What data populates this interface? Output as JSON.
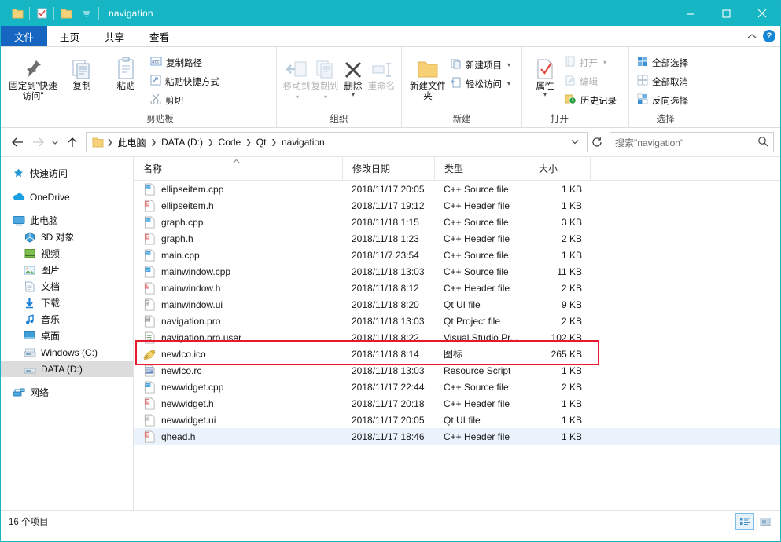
{
  "window": {
    "title": "navigation",
    "quick_access": [
      "folder-icon",
      "properties-icon",
      "new-folder-icon",
      "customize-dropdown-icon"
    ],
    "buttons": {
      "minimize": "minimize-icon",
      "maximize": "maximize-icon",
      "close": "close-icon"
    },
    "accent_color": "#16b6c4"
  },
  "tabs": [
    {
      "label": "文件",
      "name": "tab-file"
    },
    {
      "label": "主页",
      "name": "tab-home"
    },
    {
      "label": "共享",
      "name": "tab-share"
    },
    {
      "label": "查看",
      "name": "tab-view"
    }
  ],
  "ribbon": {
    "collapse_icon": "chevron-up-icon",
    "help_icon": "help-icon",
    "groups": [
      {
        "label": "剪贴板",
        "name": "ribbon-group-clipboard",
        "big": [
          {
            "label": "固定到\"快速访问\"",
            "icon": "pin-icon",
            "disabled": false
          },
          {
            "label": "复制",
            "icon": "copy-icon",
            "disabled": false
          },
          {
            "label": "粘贴",
            "icon": "paste-icon",
            "disabled": false
          }
        ],
        "small": [
          {
            "label": "复制路径",
            "icon": "copy-path-icon",
            "disabled": false
          },
          {
            "label": "粘贴快捷方式",
            "icon": "paste-shortcut-icon",
            "disabled": false
          },
          {
            "label": "剪切",
            "icon": "cut-icon",
            "disabled": false
          }
        ]
      },
      {
        "label": "组织",
        "name": "ribbon-group-organize",
        "big": [
          {
            "label": "移动到",
            "icon": "move-to-icon",
            "disabled": true,
            "dropdown": true
          },
          {
            "label": "复制到",
            "icon": "copy-to-icon",
            "disabled": true,
            "dropdown": true
          },
          {
            "label": "删除",
            "icon": "delete-icon",
            "disabled": false,
            "dropdown": true
          },
          {
            "label": "重命名",
            "icon": "rename-icon",
            "disabled": true
          }
        ],
        "small": []
      },
      {
        "label": "新建",
        "name": "ribbon-group-new",
        "big": [
          {
            "label": "新建文件夹",
            "icon": "new-folder-icon",
            "disabled": false
          }
        ],
        "small": [
          {
            "label": "新建项目",
            "icon": "new-item-icon",
            "dropdown": true
          },
          {
            "label": "轻松访问",
            "icon": "easy-access-icon",
            "dropdown": true
          }
        ]
      },
      {
        "label": "打开",
        "name": "ribbon-group-open",
        "big": [
          {
            "label": "属性",
            "icon": "properties-icon",
            "disabled": false,
            "dropdown": true
          }
        ],
        "small": [
          {
            "label": "打开",
            "icon": "open-icon",
            "disabled": true,
            "dropdown": true
          },
          {
            "label": "编辑",
            "icon": "edit-icon",
            "disabled": true
          },
          {
            "label": "历史记录",
            "icon": "history-icon",
            "disabled": false
          }
        ]
      },
      {
        "label": "选择",
        "name": "ribbon-group-select",
        "big": [],
        "small": [
          {
            "label": "全部选择",
            "icon": "select-all-icon"
          },
          {
            "label": "全部取消",
            "icon": "select-none-icon"
          },
          {
            "label": "反向选择",
            "icon": "invert-selection-icon"
          }
        ]
      }
    ]
  },
  "address": {
    "back_icon": "back-arrow-icon",
    "forward_icon": "forward-arrow-icon",
    "recent_icon": "chevron-down-icon",
    "up_icon": "up-arrow-icon",
    "folder_icon": "folder-icon",
    "breadcrumbs": [
      "此电脑",
      "DATA (D:)",
      "Code",
      "Qt",
      "navigation"
    ],
    "dropdown_icon": "chevron-down-icon",
    "refresh_icon": "refresh-icon",
    "search_placeholder": "搜索\"navigation\"",
    "search_value": "",
    "search_icon": "search-icon"
  },
  "sidebar": {
    "groups": [
      {
        "items": [
          {
            "label": "快速访问",
            "icon": "star-pin-icon",
            "level": 0,
            "selected": false
          }
        ]
      },
      {
        "items": [
          {
            "label": "OneDrive",
            "icon": "onedrive-cloud-icon",
            "level": 0,
            "selected": false
          }
        ]
      },
      {
        "items": [
          {
            "label": "此电脑",
            "icon": "this-pc-icon",
            "level": 0,
            "selected": false
          },
          {
            "label": "3D 对象",
            "icon": "3d-objects-icon",
            "level": 1,
            "selected": false
          },
          {
            "label": "视频",
            "icon": "videos-icon",
            "level": 1,
            "selected": false
          },
          {
            "label": "图片",
            "icon": "pictures-icon",
            "level": 1,
            "selected": false
          },
          {
            "label": "文档",
            "icon": "documents-icon",
            "level": 1,
            "selected": false
          },
          {
            "label": "下载",
            "icon": "downloads-icon",
            "level": 1,
            "selected": false
          },
          {
            "label": "音乐",
            "icon": "music-icon",
            "level": 1,
            "selected": false
          },
          {
            "label": "桌面",
            "icon": "desktop-icon",
            "level": 1,
            "selected": false
          },
          {
            "label": "Windows (C:)",
            "icon": "drive-icon",
            "level": 1,
            "selected": false
          },
          {
            "label": "DATA (D:)",
            "icon": "drive-icon",
            "level": 1,
            "selected": true
          }
        ]
      },
      {
        "items": [
          {
            "label": "网络",
            "icon": "network-icon",
            "level": 0,
            "selected": false
          }
        ]
      }
    ]
  },
  "filelist": {
    "columns": [
      {
        "label": "名称",
        "name": "column-name",
        "sorted": true,
        "sort_icon": "sort-asc-icon"
      },
      {
        "label": "修改日期",
        "name": "column-date"
      },
      {
        "label": "类型",
        "name": "column-type"
      },
      {
        "label": "大小",
        "name": "column-size"
      }
    ],
    "rows": [
      {
        "name": "ellipseitem.cpp",
        "date": "2018/11/17 20:05",
        "type": "C++ Source file",
        "size": "1 KB",
        "icon": "cpp-file-icon",
        "hover": false,
        "highlight": false
      },
      {
        "name": "ellipseitem.h",
        "date": "2018/11/17 19:12",
        "type": "C++ Header file",
        "size": "1 KB",
        "icon": "h-file-icon",
        "hover": false,
        "highlight": false
      },
      {
        "name": "graph.cpp",
        "date": "2018/11/18 1:15",
        "type": "C++ Source file",
        "size": "3 KB",
        "icon": "cpp-file-icon",
        "hover": false,
        "highlight": false
      },
      {
        "name": "graph.h",
        "date": "2018/11/18 1:23",
        "type": "C++ Header file",
        "size": "2 KB",
        "icon": "h-file-icon",
        "hover": false,
        "highlight": false
      },
      {
        "name": "main.cpp",
        "date": "2018/11/7 23:54",
        "type": "C++ Source file",
        "size": "1 KB",
        "icon": "cpp-file-icon",
        "hover": false,
        "highlight": false
      },
      {
        "name": "mainwindow.cpp",
        "date": "2018/11/18 13:03",
        "type": "C++ Source file",
        "size": "11 KB",
        "icon": "cpp-file-icon",
        "hover": false,
        "highlight": false
      },
      {
        "name": "mainwindow.h",
        "date": "2018/11/18 8:12",
        "type": "C++ Header file",
        "size": "2 KB",
        "icon": "h-file-icon",
        "hover": false,
        "highlight": false
      },
      {
        "name": "mainwindow.ui",
        "date": "2018/11/18 8:20",
        "type": "Qt UI file",
        "size": "9 KB",
        "icon": "ui-file-icon",
        "hover": false,
        "highlight": false
      },
      {
        "name": "navigation.pro",
        "date": "2018/11/18 13:03",
        "type": "Qt Project file",
        "size": "2 KB",
        "icon": "pro-file-icon",
        "hover": false,
        "highlight": false
      },
      {
        "name": "navigation.pro.user",
        "date": "2018/11/18 8:22",
        "type": "Visual Studio Pr...",
        "size": "102 KB",
        "icon": "user-file-icon",
        "hover": false,
        "highlight": false
      },
      {
        "name": "newIco.ico",
        "date": "2018/11/18 8:14",
        "type": "图标",
        "size": "265 KB",
        "icon": "ico-file-icon",
        "hover": false,
        "highlight": true
      },
      {
        "name": "newIco.rc",
        "date": "2018/11/18 13:03",
        "type": "Resource Script",
        "size": "1 KB",
        "icon": "rc-file-icon",
        "hover": false,
        "highlight": false
      },
      {
        "name": "newwidget.cpp",
        "date": "2018/11/17 22:44",
        "type": "C++ Source file",
        "size": "2 KB",
        "icon": "cpp-file-icon",
        "hover": false,
        "highlight": false
      },
      {
        "name": "newwidget.h",
        "date": "2018/11/17 20:18",
        "type": "C++ Header file",
        "size": "1 KB",
        "icon": "h-file-icon",
        "hover": false,
        "highlight": false
      },
      {
        "name": "newwidget.ui",
        "date": "2018/11/17 20:05",
        "type": "Qt UI file",
        "size": "1 KB",
        "icon": "ui-file-icon",
        "hover": false,
        "highlight": false
      },
      {
        "name": "qhead.h",
        "date": "2018/11/17 18:46",
        "type": "C++ Header file",
        "size": "1 KB",
        "icon": "h-file-icon",
        "hover": true,
        "highlight": false
      }
    ],
    "highlight_color": "#e8192c"
  },
  "status": {
    "item_count": "16 个项目",
    "views": [
      {
        "name": "details-view-button",
        "icon": "details-view-icon",
        "active": true
      },
      {
        "name": "large-icons-view-button",
        "icon": "large-icons-view-icon",
        "active": false
      }
    ]
  }
}
